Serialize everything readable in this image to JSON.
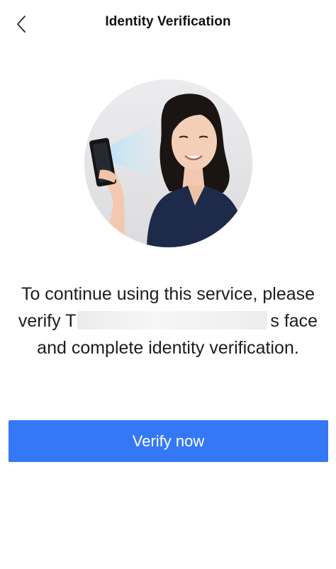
{
  "header": {
    "title": "Identity Verification",
    "back_icon": "chevron-left-icon"
  },
  "hero": {
    "image": "woman-holding-phone-face-scan-illustration"
  },
  "message": {
    "line1": "To continue using this service, please",
    "line2_prefix": "verify T",
    "line2_suffix": "s face",
    "line3": "and complete identity verification."
  },
  "actions": {
    "verify_label": "Verify now"
  },
  "colors": {
    "primary": "#3478f6",
    "text": "#1d1d1f",
    "background": "#ffffff"
  }
}
